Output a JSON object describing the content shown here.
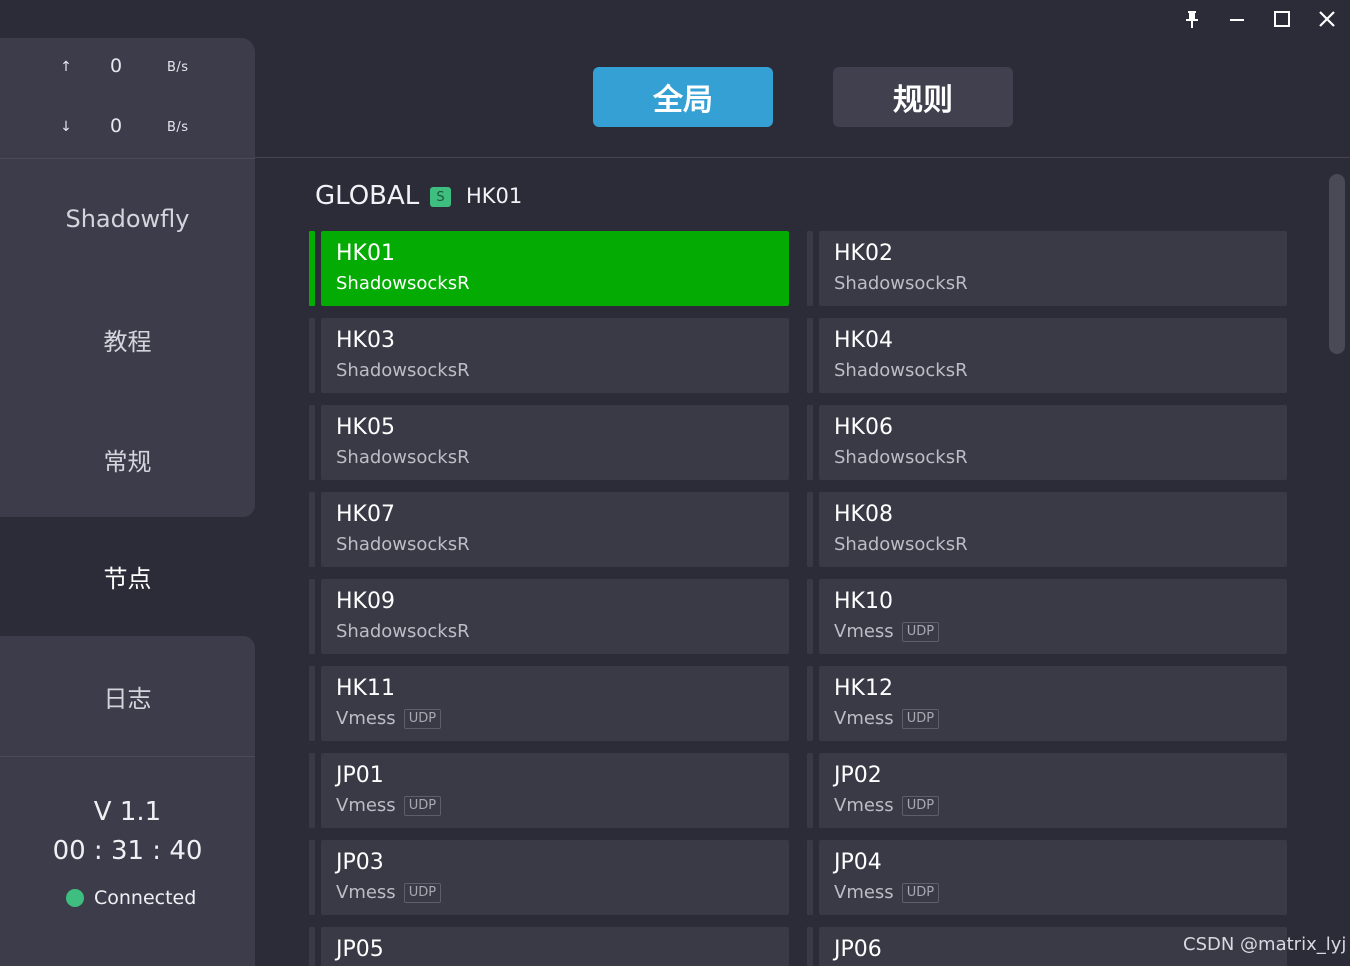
{
  "window": {
    "controls": [
      "pin-icon",
      "minimize-icon",
      "maximize-icon",
      "close-icon"
    ]
  },
  "traffic": {
    "upload": {
      "arrow": "↑",
      "value": "0",
      "unit": "B/s"
    },
    "download": {
      "arrow": "↓",
      "value": "0",
      "unit": "B/s"
    }
  },
  "sidebar": {
    "items": [
      {
        "label": "Shadowfly"
      },
      {
        "label": "教程"
      },
      {
        "label": "常规"
      },
      {
        "label": "节点"
      },
      {
        "label": "日志"
      }
    ],
    "active_index": 3,
    "version": "V 1.1",
    "timer": "00 : 31 : 40",
    "status": "Connected"
  },
  "modes": {
    "global_label": "全局",
    "rule_label": "规则",
    "active": "global"
  },
  "group": {
    "title": "GLOBAL",
    "badge": "S",
    "selected": "HK01"
  },
  "nodes": [
    {
      "name": "HK01",
      "protocol": "ShadowsocksR",
      "tag": ""
    },
    {
      "name": "HK02",
      "protocol": "ShadowsocksR",
      "tag": ""
    },
    {
      "name": "HK03",
      "protocol": "ShadowsocksR",
      "tag": ""
    },
    {
      "name": "HK04",
      "protocol": "ShadowsocksR",
      "tag": ""
    },
    {
      "name": "HK05",
      "protocol": "ShadowsocksR",
      "tag": ""
    },
    {
      "name": "HK06",
      "protocol": "ShadowsocksR",
      "tag": ""
    },
    {
      "name": "HK07",
      "protocol": "ShadowsocksR",
      "tag": ""
    },
    {
      "name": "HK08",
      "protocol": "ShadowsocksR",
      "tag": ""
    },
    {
      "name": "HK09",
      "protocol": "ShadowsocksR",
      "tag": ""
    },
    {
      "name": "HK10",
      "protocol": "Vmess",
      "tag": "UDP"
    },
    {
      "name": "HK11",
      "protocol": "Vmess",
      "tag": "UDP"
    },
    {
      "name": "HK12",
      "protocol": "Vmess",
      "tag": "UDP"
    },
    {
      "name": "JP01",
      "protocol": "Vmess",
      "tag": "UDP"
    },
    {
      "name": "JP02",
      "protocol": "Vmess",
      "tag": "UDP"
    },
    {
      "name": "JP03",
      "protocol": "Vmess",
      "tag": "UDP"
    },
    {
      "name": "JP04",
      "protocol": "Vmess",
      "tag": "UDP"
    },
    {
      "name": "JP05",
      "protocol": "",
      "tag": ""
    },
    {
      "name": "JP06",
      "protocol": "",
      "tag": ""
    }
  ],
  "colors": {
    "background": "#2c2b38",
    "panel": "#3d3c4a",
    "card": "#3a3946",
    "selected": "#03ab03",
    "accent": "#34a0d3",
    "status_ok": "#3fbf7f"
  },
  "watermark": "CSDN @matrix_lyj"
}
